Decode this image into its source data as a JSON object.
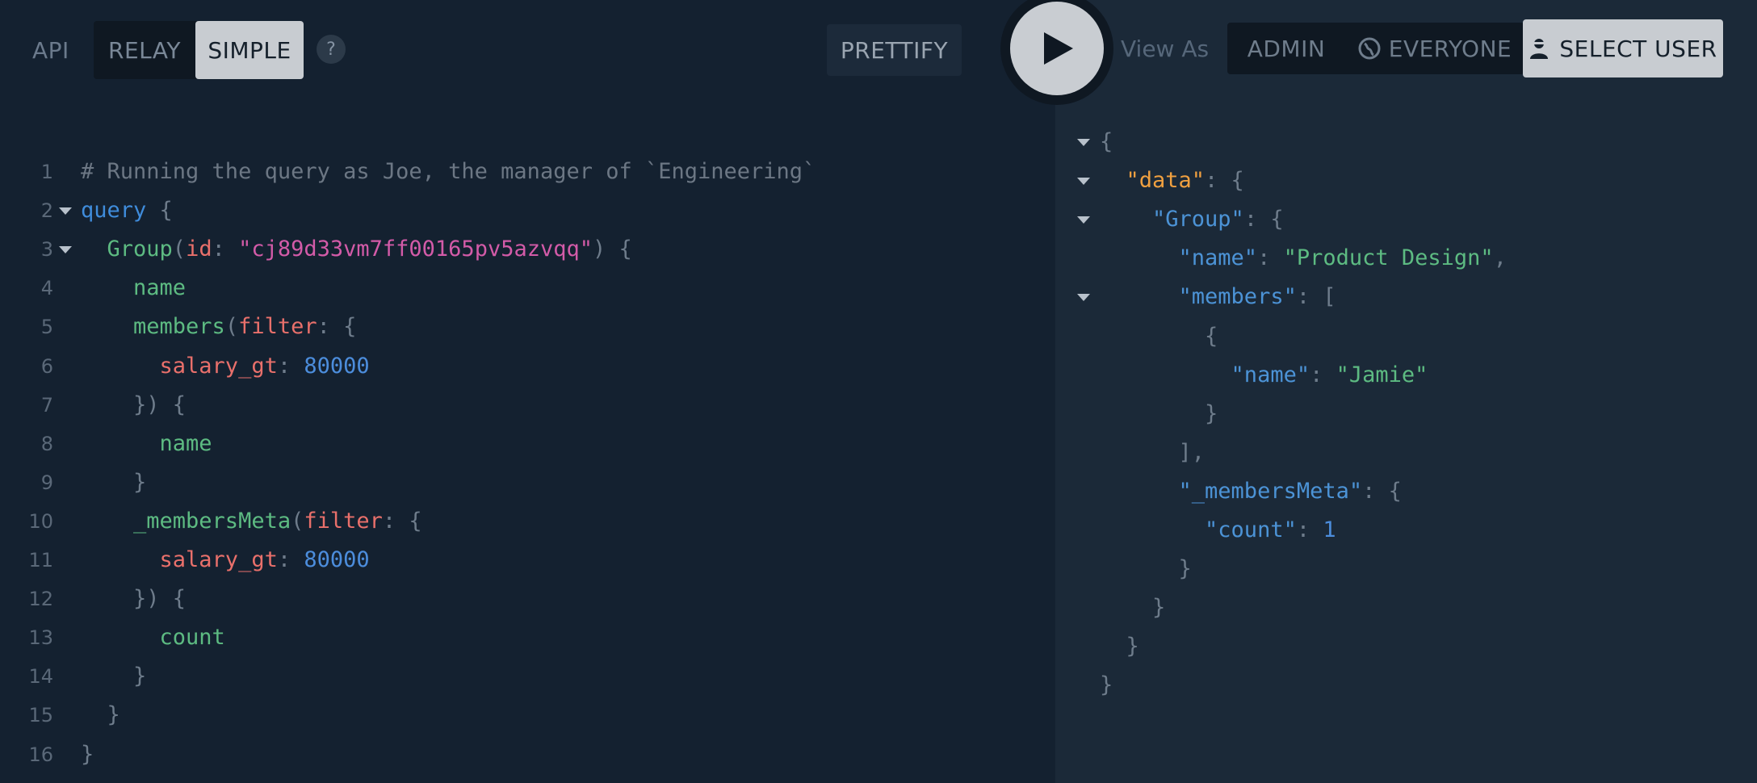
{
  "toolbar": {
    "api_label": "API",
    "relay_label": "RELAY",
    "simple_label": "SIMPLE",
    "help_label": "?",
    "prettify_label": "PRETTIFY",
    "view_as_label": "View As",
    "admin_label": "ADMIN",
    "everyone_label": "EVERYONE",
    "select_user_label": "SELECT USER"
  },
  "colors": {
    "comment": "#6c7784",
    "keyword": "#3f8cdb",
    "field": "#5dbb82",
    "argument": "#e9706b",
    "string": "#d35ba8",
    "number": "#4c8ddc",
    "punctuation": "#6e7c8b",
    "json_key": "#4c93d6",
    "data_key": "#f0a040"
  },
  "editor": {
    "lines": [
      {
        "n": "1",
        "tokens": [
          [
            "comment",
            "# Running the query as Joe, the manager of `Engineering`"
          ]
        ]
      },
      {
        "n": "2",
        "tokens": [
          [
            "kw",
            "query"
          ],
          [
            "punc",
            " {"
          ]
        ]
      },
      {
        "n": "3",
        "tokens": [
          [
            "field",
            "  Group"
          ],
          [
            "punc",
            "("
          ],
          [
            "arg",
            "id"
          ],
          [
            "punc",
            ": "
          ],
          [
            "str",
            "\"cj89d33vm7ff00165pv5azvqq\""
          ],
          [
            "punc",
            ") {"
          ]
        ]
      },
      {
        "n": "4",
        "tokens": [
          [
            "field",
            "    name"
          ]
        ]
      },
      {
        "n": "5",
        "tokens": [
          [
            "field",
            "    members"
          ],
          [
            "punc",
            "("
          ],
          [
            "arg",
            "filter"
          ],
          [
            "punc",
            ": {"
          ]
        ]
      },
      {
        "n": "6",
        "tokens": [
          [
            "arg",
            "      salary_gt"
          ],
          [
            "punc",
            ": "
          ],
          [
            "num",
            "80000"
          ]
        ]
      },
      {
        "n": "7",
        "tokens": [
          [
            "punc",
            "    }) {"
          ]
        ]
      },
      {
        "n": "8",
        "tokens": [
          [
            "field",
            "      name"
          ]
        ]
      },
      {
        "n": "9",
        "tokens": [
          [
            "punc",
            "    }"
          ]
        ]
      },
      {
        "n": "10",
        "tokens": [
          [
            "field",
            "    _membersMeta"
          ],
          [
            "punc",
            "("
          ],
          [
            "arg",
            "filter"
          ],
          [
            "punc",
            ": {"
          ]
        ]
      },
      {
        "n": "11",
        "tokens": [
          [
            "arg",
            "      salary_gt"
          ],
          [
            "punc",
            ": "
          ],
          [
            "num",
            "80000"
          ]
        ]
      },
      {
        "n": "12",
        "tokens": [
          [
            "punc",
            "    }) {"
          ]
        ]
      },
      {
        "n": "13",
        "tokens": [
          [
            "field",
            "      count"
          ]
        ]
      },
      {
        "n": "14",
        "tokens": [
          [
            "punc",
            "    }"
          ]
        ]
      },
      {
        "n": "15",
        "tokens": [
          [
            "punc",
            "  }"
          ]
        ]
      },
      {
        "n": "16",
        "tokens": [
          [
            "punc",
            "}"
          ]
        ]
      }
    ]
  },
  "result": {
    "lines": [
      {
        "tokens": [
          [
            "punc",
            "{"
          ]
        ]
      },
      {
        "tokens": [
          [
            "datakey",
            "  \"data\""
          ],
          [
            "punc",
            ": {"
          ]
        ]
      },
      {
        "tokens": [
          [
            "key",
            "    \"Group\""
          ],
          [
            "punc",
            ": {"
          ]
        ]
      },
      {
        "tokens": [
          [
            "key",
            "      \"name\""
          ],
          [
            "punc",
            ": "
          ],
          [
            "sval",
            "\"Product Design\""
          ],
          [
            "punc",
            ","
          ]
        ]
      },
      {
        "tokens": [
          [
            "key",
            "      \"members\""
          ],
          [
            "punc",
            ": ["
          ]
        ]
      },
      {
        "tokens": [
          [
            "punc",
            "        {"
          ]
        ]
      },
      {
        "tokens": [
          [
            "key",
            "          \"name\""
          ],
          [
            "punc",
            ": "
          ],
          [
            "sval",
            "\"Jamie\""
          ]
        ]
      },
      {
        "tokens": [
          [
            "punc",
            "        }"
          ]
        ]
      },
      {
        "tokens": [
          [
            "punc",
            "      ],"
          ]
        ]
      },
      {
        "tokens": [
          [
            "key",
            "      \"_membersMeta\""
          ],
          [
            "punc",
            ": {"
          ]
        ]
      },
      {
        "tokens": [
          [
            "key",
            "        \"count\""
          ],
          [
            "punc",
            ": "
          ],
          [
            "num",
            "1"
          ]
        ]
      },
      {
        "tokens": [
          [
            "punc",
            "      }"
          ]
        ]
      },
      {
        "tokens": [
          [
            "punc",
            "    }"
          ]
        ]
      },
      {
        "tokens": [
          [
            "punc",
            "  }"
          ]
        ]
      },
      {
        "tokens": [
          [
            "punc",
            "}"
          ]
        ]
      }
    ]
  }
}
